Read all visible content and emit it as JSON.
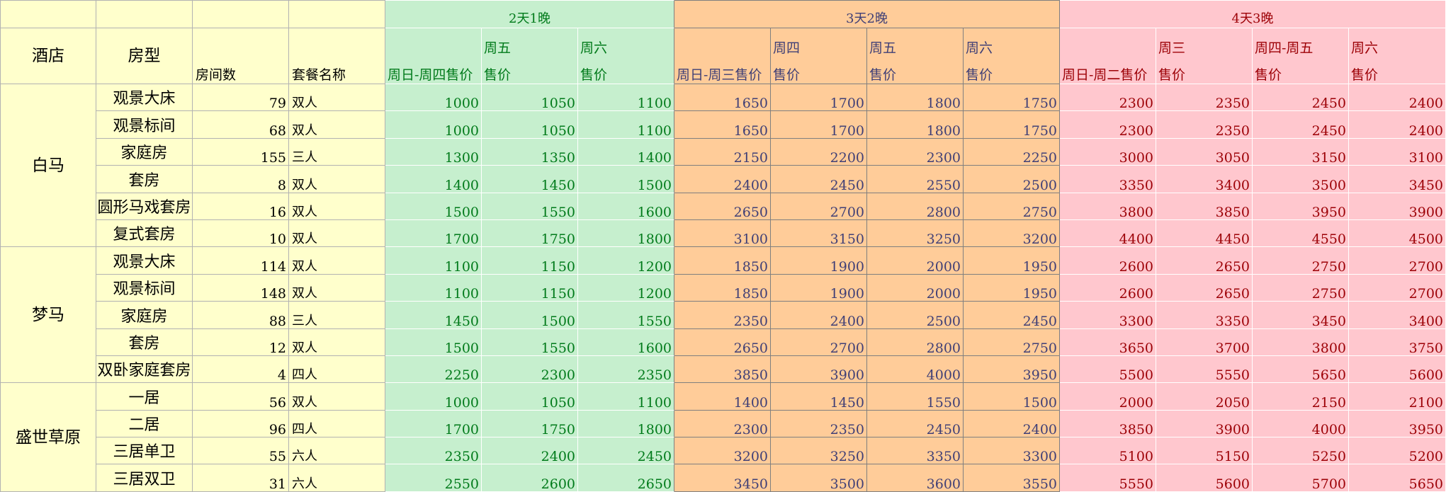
{
  "palette": {
    "base": {
      "fill": "#FFFFCC",
      "text": "#000000",
      "border": "#B2B2B2"
    },
    "stays": [
      {
        "fill": "#C6EFCE",
        "text": "#007A1A",
        "border": "#FFFFFF"
      },
      {
        "fill": "#FFCC99",
        "text": "#3F3F76",
        "border": "#7F7F7F"
      },
      {
        "fill": "#FFC7CE",
        "text": "#9C0006",
        "border": "#FFFFFF"
      }
    ]
  },
  "header": {
    "hotel": "酒店",
    "room_type": "房型",
    "room_count": "房间数",
    "package": "套餐名称",
    "stays": [
      {
        "label": "2天1晚",
        "columns": [
          {
            "lines": [
              "周日-周四售价"
            ]
          },
          {
            "lines": [
              "周五",
              "售价"
            ]
          },
          {
            "lines": [
              "周六",
              "售价"
            ]
          }
        ]
      },
      {
        "label": "3天2晚",
        "columns": [
          {
            "lines": [
              "周日-周三售价"
            ]
          },
          {
            "lines": [
              "周四",
              "售价"
            ]
          },
          {
            "lines": [
              "周五",
              "售价"
            ]
          },
          {
            "lines": [
              "周六",
              "售价"
            ]
          }
        ]
      },
      {
        "label": "4天3晚",
        "columns": [
          {
            "lines": [
              "周日-周二售价"
            ]
          },
          {
            "lines": [
              "周三",
              "售价"
            ]
          },
          {
            "lines": [
              "周四-周五",
              "售价"
            ]
          },
          {
            "lines": [
              "周六",
              "售价"
            ]
          }
        ]
      }
    ]
  },
  "hotels": [
    {
      "name": "白马",
      "rooms": [
        {
          "type": "观景大床",
          "count": 79,
          "package": "双人",
          "prices": [
            [
              1000,
              1050,
              1100
            ],
            [
              1650,
              1700,
              1800,
              1750
            ],
            [
              2300,
              2350,
              2450,
              2400
            ]
          ]
        },
        {
          "type": "观景标间",
          "count": 68,
          "package": "双人",
          "prices": [
            [
              1000,
              1050,
              1100
            ],
            [
              1650,
              1700,
              1800,
              1750
            ],
            [
              2300,
              2350,
              2450,
              2400
            ]
          ]
        },
        {
          "type": "家庭房",
          "count": 155,
          "package": "三人",
          "prices": [
            [
              1300,
              1350,
              1400
            ],
            [
              2150,
              2200,
              2300,
              2250
            ],
            [
              3000,
              3050,
              3150,
              3100
            ]
          ]
        },
        {
          "type": "套房",
          "count": 8,
          "package": "双人",
          "prices": [
            [
              1400,
              1450,
              1500
            ],
            [
              2400,
              2450,
              2550,
              2500
            ],
            [
              3350,
              3400,
              3500,
              3450
            ]
          ]
        },
        {
          "type": "圆形马戏套房",
          "count": 16,
          "package": "双人",
          "prices": [
            [
              1500,
              1550,
              1600
            ],
            [
              2650,
              2700,
              2800,
              2750
            ],
            [
              3800,
              3850,
              3950,
              3900
            ]
          ]
        },
        {
          "type": "复式套房",
          "count": 10,
          "package": "双人",
          "prices": [
            [
              1700,
              1750,
              1800
            ],
            [
              3100,
              3150,
              3250,
              3200
            ],
            [
              4400,
              4450,
              4550,
              4500
            ]
          ]
        }
      ]
    },
    {
      "name": "梦马",
      "rooms": [
        {
          "type": "观景大床",
          "count": 114,
          "package": "双人",
          "prices": [
            [
              1100,
              1150,
              1200
            ],
            [
              1850,
              1900,
              2000,
              1950
            ],
            [
              2600,
              2650,
              2750,
              2700
            ]
          ]
        },
        {
          "type": "观景标间",
          "count": 148,
          "package": "双人",
          "prices": [
            [
              1100,
              1150,
              1200
            ],
            [
              1850,
              1900,
              2000,
              1950
            ],
            [
              2600,
              2650,
              2750,
              2700
            ]
          ]
        },
        {
          "type": "家庭房",
          "count": 88,
          "package": "三人",
          "prices": [
            [
              1450,
              1500,
              1550
            ],
            [
              2350,
              2400,
              2500,
              2450
            ],
            [
              3300,
              3350,
              3450,
              3400
            ]
          ]
        },
        {
          "type": "套房",
          "count": 12,
          "package": "双人",
          "prices": [
            [
              1500,
              1550,
              1600
            ],
            [
              2650,
              2700,
              2800,
              2750
            ],
            [
              3650,
              3700,
              3800,
              3750
            ]
          ]
        },
        {
          "type": "双卧家庭套房",
          "count": 4,
          "package": "四人",
          "prices": [
            [
              2250,
              2300,
              2350
            ],
            [
              3850,
              3900,
              4000,
              3950
            ],
            [
              5500,
              5550,
              5650,
              5600
            ]
          ]
        }
      ]
    },
    {
      "name": "盛世草原",
      "rooms": [
        {
          "type": "一居",
          "count": 56,
          "package": "双人",
          "prices": [
            [
              1000,
              1050,
              1100
            ],
            [
              1400,
              1450,
              1550,
              1500
            ],
            [
              2000,
              2050,
              2150,
              2100
            ]
          ]
        },
        {
          "type": "二居",
          "count": 96,
          "package": "四人",
          "prices": [
            [
              1700,
              1750,
              1800
            ],
            [
              2300,
              2350,
              2450,
              2400
            ],
            [
              3850,
              3900,
              4000,
              3950
            ]
          ]
        },
        {
          "type": "三居单卫",
          "count": 55,
          "package": "六人",
          "prices": [
            [
              2350,
              2400,
              2450
            ],
            [
              3200,
              3250,
              3350,
              3300
            ],
            [
              5100,
              5150,
              5250,
              5200
            ]
          ]
        },
        {
          "type": "三居双卫",
          "count": 31,
          "package": "六人",
          "prices": [
            [
              2550,
              2600,
              2650
            ],
            [
              3450,
              3500,
              3600,
              3550
            ],
            [
              5550,
              5600,
              5700,
              5650
            ]
          ]
        }
      ]
    }
  ]
}
